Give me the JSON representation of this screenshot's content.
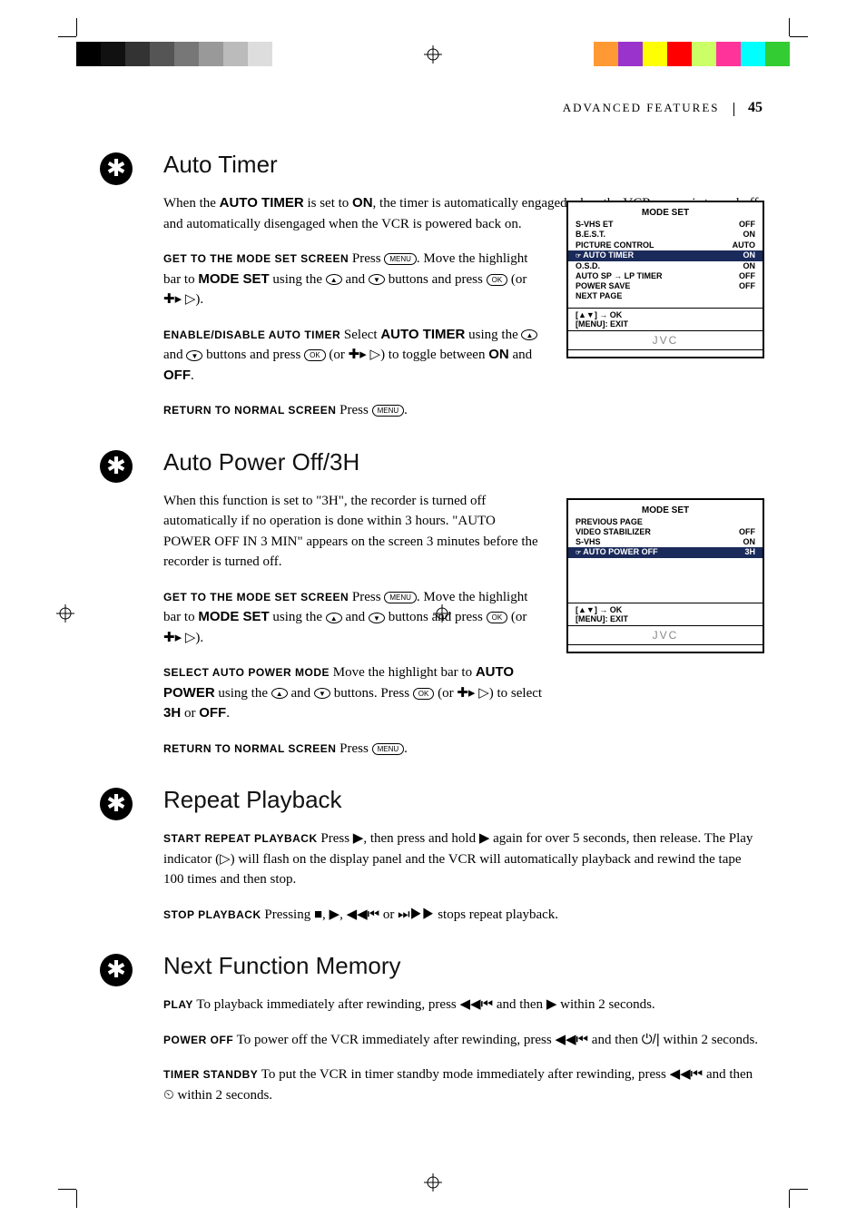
{
  "header": {
    "category": "ADVANCED FEATURES",
    "page_number": "45"
  },
  "sections": {
    "auto_timer": {
      "title": "Auto Timer",
      "intro_a": "When the ",
      "intro_b": "AUTO TIMER",
      "intro_c": " is set to ",
      "intro_d": "ON",
      "intro_e": ", the timer is automatically engaged when the VCR power is turned off and automatically disengaged when the VCR is powered back on.",
      "step1_lead": "GET TO THE MODE SET SCREEN",
      "step1_a": "  Press ",
      "step1_b": ". Move the highlight bar to ",
      "step1_c": "MODE SET",
      "step1_d": " using the ",
      "step1_e": " and ",
      "step1_f": " buttons and press ",
      "step1_g": " (or ",
      "step1_h": ").",
      "step2_lead": "ENABLE/DISABLE AUTO TIMER",
      "step2_a": "  Select ",
      "step2_b": "AUTO TIMER",
      "step2_c": " using the ",
      "step2_d": " and ",
      "step2_e": " buttons and press ",
      "step2_f": " (or ",
      "step2_g": ") to toggle between ",
      "step2_h": "ON",
      "step2_i": " and ",
      "step2_j": "OFF",
      "step2_k": ".",
      "step3_lead": "RETURN TO NORMAL SCREEN",
      "step3_a": "  Press ",
      "step3_b": "."
    },
    "auto_power": {
      "title": "Auto Power Off/3H",
      "intro": "When this function is set to \"3H\", the recorder is turned off automatically if no operation is done within 3 hours. \"AUTO POWER OFF IN 3 MIN\" appears on the screen 3 minutes before the recorder is turned off.",
      "step1_lead": "GET TO THE MODE SET SCREEN",
      "step1_a": "  Press ",
      "step1_b": ". Move the highlight bar to ",
      "step1_c": "MODE SET",
      "step1_d": " using the ",
      "step1_e": " and ",
      "step1_f": " buttons and press ",
      "step1_g": " (or ",
      "step1_h": ").",
      "step2_lead": "SELECT AUTO POWER MODE",
      "step2_a": "  Move the highlight bar to ",
      "step2_b": "AUTO POWER",
      "step2_c": " using the ",
      "step2_d": " and ",
      "step2_e": " buttons. Press ",
      "step2_f": " (or ",
      "step2_g": ") to select ",
      "step2_h": "3H",
      "step2_i": " or ",
      "step2_j": "OFF",
      "step2_k": ".",
      "step3_lead": "RETURN TO NORMAL SCREEN",
      "step3_a": "  Press ",
      "step3_b": "."
    },
    "repeat": {
      "title": "Repeat Playback",
      "step1_lead": "START REPEAT PLAYBACK",
      "step1_a": "  Press ",
      "step1_b": ", then press and hold ",
      "step1_c": " again for over 5 seconds, then release. The Play indicator (",
      "step1_d": ") will flash on the display panel and the VCR will automatically playback and rewind the tape 100 times and then stop.",
      "step2_lead": "STOP PLAYBACK",
      "step2_a": "  Pressing ",
      "step2_b": ", ",
      "step2_c": ", ",
      "step2_d": " or ",
      "step2_e": " stops repeat playback."
    },
    "next_func": {
      "title": "Next Function Memory",
      "step1_lead": "PLAY",
      "step1_a": "  To playback immediately after rewinding, press ",
      "step1_b": " and then ",
      "step1_c": " within 2 seconds.",
      "step2_lead": "POWER OFF",
      "step2_a": "  To power off the VCR immediately after rewinding, press ",
      "step2_b": " and then ",
      "step2_c": " within 2 seconds.",
      "step3_lead": "TIMER STANDBY",
      "step3_a": "  To put the VCR in timer standby mode immediately after rewinding, press ",
      "step3_b": " and then ",
      "step3_c": " within 2 seconds."
    }
  },
  "osd1": {
    "title": "MODE SET",
    "rows": [
      {
        "label": "S-VHS ET",
        "val": "OFF"
      },
      {
        "label": "B.E.S.T.",
        "val": "ON"
      },
      {
        "label": "PICTURE CONTROL",
        "val": "AUTO"
      },
      {
        "label": "AUTO TIMER",
        "val": "ON",
        "hl": true
      },
      {
        "label": "O.S.D.",
        "val": "ON"
      },
      {
        "label": "AUTO SP → LP TIMER",
        "val": "OFF"
      },
      {
        "label": "POWER SAVE",
        "val": "OFF"
      },
      {
        "label": "NEXT PAGE",
        "val": ""
      }
    ],
    "footer1": "[▲▼] → OK",
    "footer2": "[MENU]: EXIT",
    "logo": "JVC"
  },
  "osd2": {
    "title": "MODE SET",
    "rows": [
      {
        "label": "PREVIOUS PAGE",
        "val": ""
      },
      {
        "label": "VIDEO STABILIZER",
        "val": "OFF"
      },
      {
        "label": "S-VHS",
        "val": "ON"
      },
      {
        "label": "AUTO POWER OFF",
        "val": "3H",
        "hl": true
      }
    ],
    "footer1": "[▲▼] → OK",
    "footer2": "[MENU]: EXIT",
    "logo": "JVC"
  },
  "buttons": {
    "menu": "MENU",
    "ok": "OK",
    "up": "▲",
    "down": "▼"
  },
  "icons": {
    "shuttle_right": "▷",
    "shuttle_plus": "✚▸",
    "play": "▶",
    "play_outline": "▷",
    "stop": "■",
    "rew": "◀◀⏮",
    "ff": "⏭▶▶",
    "power": "⏻/|",
    "timer": "⏲"
  }
}
